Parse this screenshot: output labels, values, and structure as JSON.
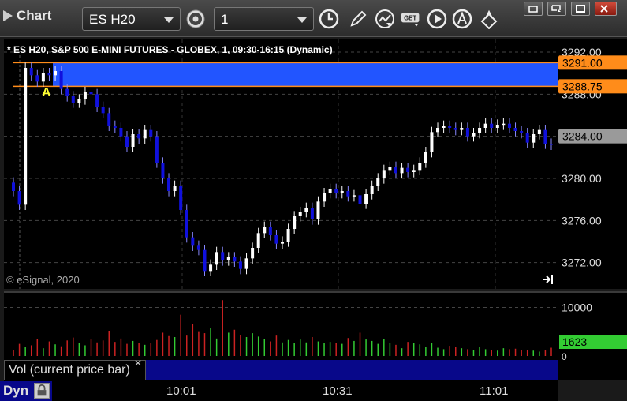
{
  "toolbar": {
    "app_title": "Chart",
    "symbol": "ES H20",
    "interval": "1",
    "icons": [
      "settings-gear-icon",
      "clock-icon",
      "pencil-icon",
      "study-icon",
      "get-icon",
      "play-icon",
      "alert-icon",
      "link-icon"
    ],
    "get_label": "GET",
    "window_buttons": [
      "restore-icon",
      "tile-icon",
      "maximize-icon",
      "close-icon"
    ]
  },
  "chart_title": "* ES H20, S&P 500 E-MINI FUTURES - GLOBEX, 1, 09:30-16:15 (Dynamic)",
  "copyright": "© eSignal, 2020",
  "marker_label": "A",
  "price_axis": {
    "ticks": [
      "3292.00",
      "3288.00",
      "3284.00",
      "3280.00",
      "3276.00",
      "3272.00"
    ],
    "tags": [
      {
        "label": "3291.00",
        "color": "#ff8c1a"
      },
      {
        "label": "3288.75",
        "color": "#ff8c1a"
      },
      {
        "label": "3284.00",
        "color": "#9a9a9a"
      }
    ]
  },
  "volume_axis": {
    "ticks": [
      "10000",
      "0"
    ],
    "tag": "1623"
  },
  "volume_legend": "Vol (current price bar)",
  "time_axis": [
    "10:01",
    "10:31",
    "11:01"
  ],
  "dyn_label": "Dyn",
  "colors": {
    "up": "#ffffff",
    "down": "#1010dd",
    "highlight": "#2255ff",
    "zone_line": "#ff8c1a",
    "vol_up": "#33cc33",
    "vol_down": "#cc2222"
  },
  "chart_data": {
    "type": "candlestick",
    "title": "* ES H20, S&P 500 E-MINI FUTURES - GLOBEX, 1, 09:30-16:15 (Dynamic)",
    "x": [
      "10:01",
      "10:31",
      "11:01"
    ],
    "ylim": [
      3269.5,
      3293.2
    ],
    "zone": [
      3288.75,
      3291.0
    ],
    "last_price": 3284.0,
    "series": [
      {
        "close": [
          3278.8,
          3277.5,
          3290.5,
          3289.8,
          3289.2,
          3290.0,
          3289.8,
          3290.2,
          3288.5,
          3287.8,
          3287.2,
          3287.5,
          3288.2,
          3288.0,
          3286.8,
          3286.2,
          3285.0,
          3284.8,
          3284.0,
          3283.0,
          3284.2,
          3283.8,
          3284.6,
          3284.0,
          3281.5,
          3280.0,
          3278.8,
          3279.3,
          3277.0,
          3274.4,
          3273.6,
          3273.2,
          3271.2,
          3271.8,
          3273.0,
          3272.2,
          3272.5,
          3272.1,
          3271.4,
          3272.4,
          3273.4,
          3274.8,
          3275.4,
          3274.6,
          3273.8,
          3274.0,
          3275.2,
          3276.4,
          3276.8,
          3277.2,
          3276.1,
          3277.8,
          3278.6,
          3279.0,
          3278.6,
          3278.8,
          3278.3,
          3278.4,
          3277.6,
          3278.5,
          3279.3,
          3280.0,
          3280.8,
          3281.1,
          3280.5,
          3281.0,
          3280.6,
          3280.8,
          3281.5,
          3282.5,
          3284.4,
          3284.8,
          3285.0,
          3284.8,
          3284.6,
          3284.8,
          3284.0,
          3284.3,
          3284.8,
          3285.2,
          3284.8,
          3285.1,
          3285.2,
          3284.8,
          3284.5,
          3284.3,
          3283.4,
          3284.2,
          3284.6,
          3283.3,
          3283.2
        ],
        "name": "",
        "values": [
          3278.8,
          3277.5,
          3290.5,
          3289.8,
          3289.2,
          3290.0,
          3289.8,
          3290.2,
          3288.5,
          3287.8,
          3287.2,
          3287.5,
          3288.2,
          3288.0,
          3286.8,
          3286.2,
          3285.0,
          3284.8,
          3284.0,
          3283.0,
          3284.2,
          3283.8,
          3284.6,
          3284.0,
          3281.5,
          3280.0,
          3278.8,
          3279.3,
          3277.0,
          3274.4,
          3273.6,
          3273.2,
          3271.2,
          3271.8,
          3273.0,
          3272.2,
          3272.5,
          3272.1,
          3271.4,
          3272.4,
          3273.4,
          3274.8,
          3275.4,
          3274.6,
          3273.8,
          3274.0,
          3275.2,
          3276.4,
          3276.8,
          3277.2,
          3276.1,
          3277.8,
          3278.6,
          3279.0,
          3278.6,
          3278.8,
          3278.3,
          3278.4,
          3277.6,
          3278.5,
          3279.3,
          3280.0,
          3280.8,
          3281.1,
          3280.5,
          3281.0,
          3280.6,
          3280.8,
          3281.5,
          3282.5,
          3284.4,
          3284.8,
          3285.0,
          3284.8,
          3284.6,
          3284.8,
          3284.0,
          3284.3,
          3284.8,
          3285.2,
          3284.8,
          3285.1,
          3285.2,
          3284.8,
          3284.5,
          3284.3,
          3283.4,
          3284.2,
          3284.6,
          3283.3,
          3283.2
        ]
      }
    ],
    "volume": [
      1200,
      2500,
      1800,
      2200,
      3500,
      1600,
      3000,
      2400,
      2000,
      3200,
      3800,
      2600,
      2200,
      3400,
      2800,
      3200,
      5200,
      2900,
      3600,
      2500,
      3100,
      2700,
      2300,
      2600,
      3300,
      4800,
      4100,
      3900,
      8500,
      4200,
      6600,
      5100,
      4700,
      5700,
      3600,
      11500,
      4800,
      5400,
      4300,
      3900,
      4700,
      4000,
      3500,
      3000,
      4200,
      2800,
      3300,
      2600,
      3400,
      2800,
      3900,
      3000,
      2600,
      2900,
      2700,
      2500,
      3700,
      3100,
      4800,
      3400,
      3100,
      2500,
      3500,
      2700,
      2300,
      1600,
      2900,
      2600,
      2400,
      1900,
      2600,
      1700,
      1400,
      2100,
      1800,
      1600,
      1400,
      1200,
      1900,
      1400,
      1300,
      1100,
      1600,
      1400,
      1500,
      1200,
      1300,
      1100,
      900,
      1200,
      1700
    ],
    "vol_ylim": [
      0,
      13000
    ]
  }
}
